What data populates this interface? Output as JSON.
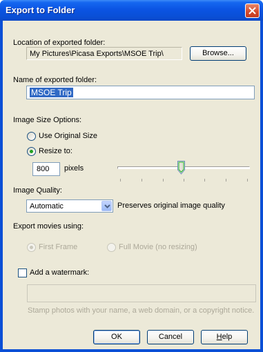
{
  "window": {
    "title": "Export to Folder"
  },
  "location": {
    "label": "Location of exported folder:",
    "path": "My Pictures\\Picasa Exports\\MSOE Trip\\",
    "browse_label": "Browse..."
  },
  "name": {
    "label": "Name of exported folder:",
    "value": "MSOE Trip"
  },
  "size": {
    "label": "Image Size Options:",
    "original_label": "Use Original Size",
    "resize_label": "Resize to:",
    "pixels_value": "800",
    "pixels_unit": "pixels",
    "selected": "resize",
    "slider_fraction": 0.48
  },
  "quality": {
    "label": "Image Quality:",
    "selected": "Automatic",
    "description": "Preserves original image quality"
  },
  "movies": {
    "label": "Export movies using:",
    "first_frame_label": "First Frame",
    "full_movie_label": "Full Movie (no resizing)",
    "selected": "first_frame",
    "disabled": true
  },
  "watermark": {
    "checkbox_label": "Add a watermark:",
    "checked": false,
    "field_value": "",
    "hint": "Stamp photos with your name, a web domain, or a copyright notice."
  },
  "buttons": {
    "ok": "OK",
    "cancel": "Cancel",
    "help_first": "H",
    "help_rest": "elp"
  },
  "colors": {
    "title_bar": "#0a4fd6",
    "dialog_bg": "#ece9d8",
    "selection": "#316ac5",
    "radio_dot": "#21a121",
    "close_button": "#d5492b"
  }
}
